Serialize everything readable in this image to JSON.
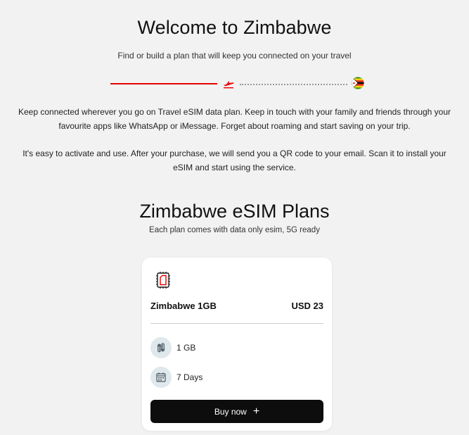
{
  "hero": {
    "title": "Welcome to Zimbabwe",
    "subtitle": "Find or build a plan that will keep you connected on your travel"
  },
  "journey": {
    "plane_icon": "plane-departure-icon",
    "flag_icon": "zimbabwe-flag-icon",
    "accent_color": "#e60000"
  },
  "intro": {
    "paragraph_1": "Keep connected wherever you go on Travel eSIM data plan. Keep in touch with your family and friends through your favourite apps like WhatsApp or iMessage. Forget about roaming and start saving on your trip.",
    "paragraph_2": "It's easy to activate and use. After your purchase, we will send you a QR code to your email. Scan it to install your eSIM and start using the service."
  },
  "plans": {
    "title": "Zimbabwe eSIM Plans",
    "subtitle": "Each plan comes with data only esim, 5G ready",
    "items": [
      {
        "icon": "sim-card-icon",
        "name": "Zimbabwe 1GB",
        "price": "USD 23",
        "data": "1 GB",
        "data_icon": "data-transfer-icon",
        "duration": "7 Days",
        "duration_icon": "calendar-icon",
        "button_label": "Buy now",
        "button_icon": "plus-icon"
      }
    ]
  }
}
